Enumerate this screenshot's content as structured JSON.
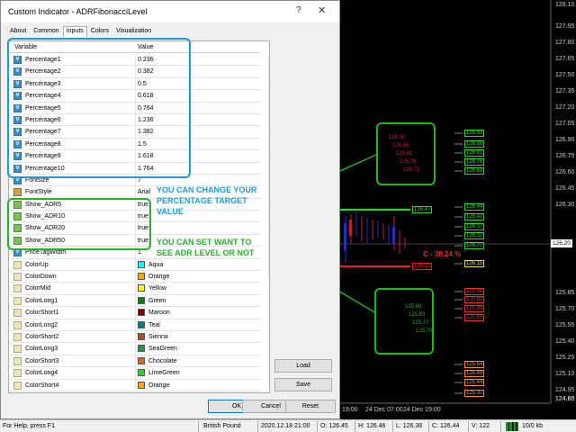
{
  "dialog": {
    "title": "Custom Indicator - ADRFibonacciLevel",
    "help_glyph": "?",
    "close_glyph": "✕",
    "tabs": [
      "About",
      "Common",
      "Inputs",
      "Colors",
      "Visualization"
    ],
    "active_tab": "Inputs",
    "columns": {
      "variable": "Variable",
      "value": "Value"
    },
    "rows": [
      {
        "name": "Percentage1",
        "value": "0.236",
        "type": "num"
      },
      {
        "name": "Percentage2",
        "value": "0.382",
        "type": "num"
      },
      {
        "name": "Percentage3",
        "value": "0.5",
        "type": "num"
      },
      {
        "name": "Percentage4",
        "value": "0.618",
        "type": "num"
      },
      {
        "name": "Percentage5",
        "value": "0.764",
        "type": "num"
      },
      {
        "name": "Percentage6",
        "value": "1.236",
        "type": "num"
      },
      {
        "name": "Percentage7",
        "value": "1.382",
        "type": "num"
      },
      {
        "name": "Percentage8",
        "value": "1.5",
        "type": "num"
      },
      {
        "name": "Percentage9",
        "value": "1.618",
        "type": "num"
      },
      {
        "name": "Percentage10",
        "value": "1.764",
        "type": "num"
      },
      {
        "name": "Fontsize",
        "value": "7",
        "type": "num"
      },
      {
        "name": "FontStyle",
        "value": "Arial",
        "type": "font"
      },
      {
        "name": "Show_ADR5",
        "value": "true",
        "type": "bool"
      },
      {
        "name": "Show_ADR10",
        "value": "true",
        "type": "bool"
      },
      {
        "name": "Show_ADR20",
        "value": "true",
        "type": "bool"
      },
      {
        "name": "Show_ADR50",
        "value": "true",
        "type": "bool"
      },
      {
        "name": "PriceTagWidth",
        "value": "1",
        "type": "num"
      },
      {
        "name": "ColorUp",
        "value": "Aqua",
        "type": "color",
        "swatch": "#00ffff"
      },
      {
        "name": "ColorDown",
        "value": "Orange",
        "type": "color",
        "swatch": "#ffa500"
      },
      {
        "name": "ColorMid",
        "value": "Yellow",
        "type": "color",
        "swatch": "#ffff00"
      },
      {
        "name": "ColorLong1",
        "value": "Green",
        "type": "color",
        "swatch": "#008000"
      },
      {
        "name": "ColorShort1",
        "value": "Maroon",
        "type": "color",
        "swatch": "#800000"
      },
      {
        "name": "ColorLong2",
        "value": "Teal",
        "type": "color",
        "swatch": "#008080"
      },
      {
        "name": "ColorShort2",
        "value": "Sienna",
        "type": "color",
        "swatch": "#a0522d"
      },
      {
        "name": "ColorLong3",
        "value": "SeaGreen",
        "type": "color",
        "swatch": "#2e8b57"
      },
      {
        "name": "ColorShort3",
        "value": "Chocolate",
        "type": "color",
        "swatch": "#d2691e"
      },
      {
        "name": "ColorLong4",
        "value": "LimeGreen",
        "type": "color",
        "swatch": "#32cd32"
      },
      {
        "name": "ColorShort4",
        "value": "Orange",
        "type": "color",
        "swatch": "#ffa500"
      }
    ],
    "buttons": {
      "load": "Load",
      "save": "Save",
      "ok": "OK",
      "cancel": "Cancel",
      "reset": "Reset"
    }
  },
  "annotations": {
    "percentage": "YOU CAN CHANGE YOUR PERCENTAGE TARGET VALUE",
    "adr": "YOU CAN SET WANT TO SEE ADR LEVEL OR NOT",
    "blue": "#1e9ad6",
    "green": "#27b02a"
  },
  "chart": {
    "price_axis": [
      "128.10",
      "127.95",
      "127.80",
      "127.65",
      "127.50",
      "127.35",
      "127.20",
      "127.05",
      "126.90",
      "126.75",
      "126.60",
      "126.45",
      "126.30",
      "126.20",
      "126.15",
      "125.85",
      "125.70",
      "125.55",
      "125.40",
      "125.25",
      "125.10",
      "124.95",
      "124.80",
      "124.65"
    ],
    "time_labels": [
      "19:00",
      "24 Dec 07:00",
      "24 Dec 19:00"
    ],
    "current_price": "126.20",
    "percent_label": "C - 38.24 %",
    "green_line_label": "126.47",
    "red_line_label": "126.13",
    "right_labels_top": [
      "126.93",
      "126.86",
      "126.81",
      "126.76",
      "126.69"
    ],
    "right_labels_mid": [
      "126.49",
      "126.42",
      "126.37",
      "126.32",
      "126.27"
    ],
    "right_label_yellow": "126.15",
    "right_labels_low": [
      "125.98",
      "125.92",
      "125.88",
      "125.83"
    ],
    "right_labels_bottom": [
      "125.54",
      "125.49",
      "125.44",
      "125.37"
    ],
    "box1_labels": [
      "126.90",
      "126.86",
      "126.81",
      "126.76",
      "126.71"
    ],
    "box2_labels": [
      "125.88",
      "125.83",
      "125.77",
      "125.70"
    ]
  },
  "status": {
    "help": "For Help, press F1",
    "symbol": "British Pound",
    "datetime": "2020.12.18 21:00",
    "open": "O: 126.45",
    "high": "H: 126.46",
    "low": "L: 126.38",
    "close": "C: 126.44",
    "volume": "V: 122",
    "traffic": "10/0 kb"
  }
}
